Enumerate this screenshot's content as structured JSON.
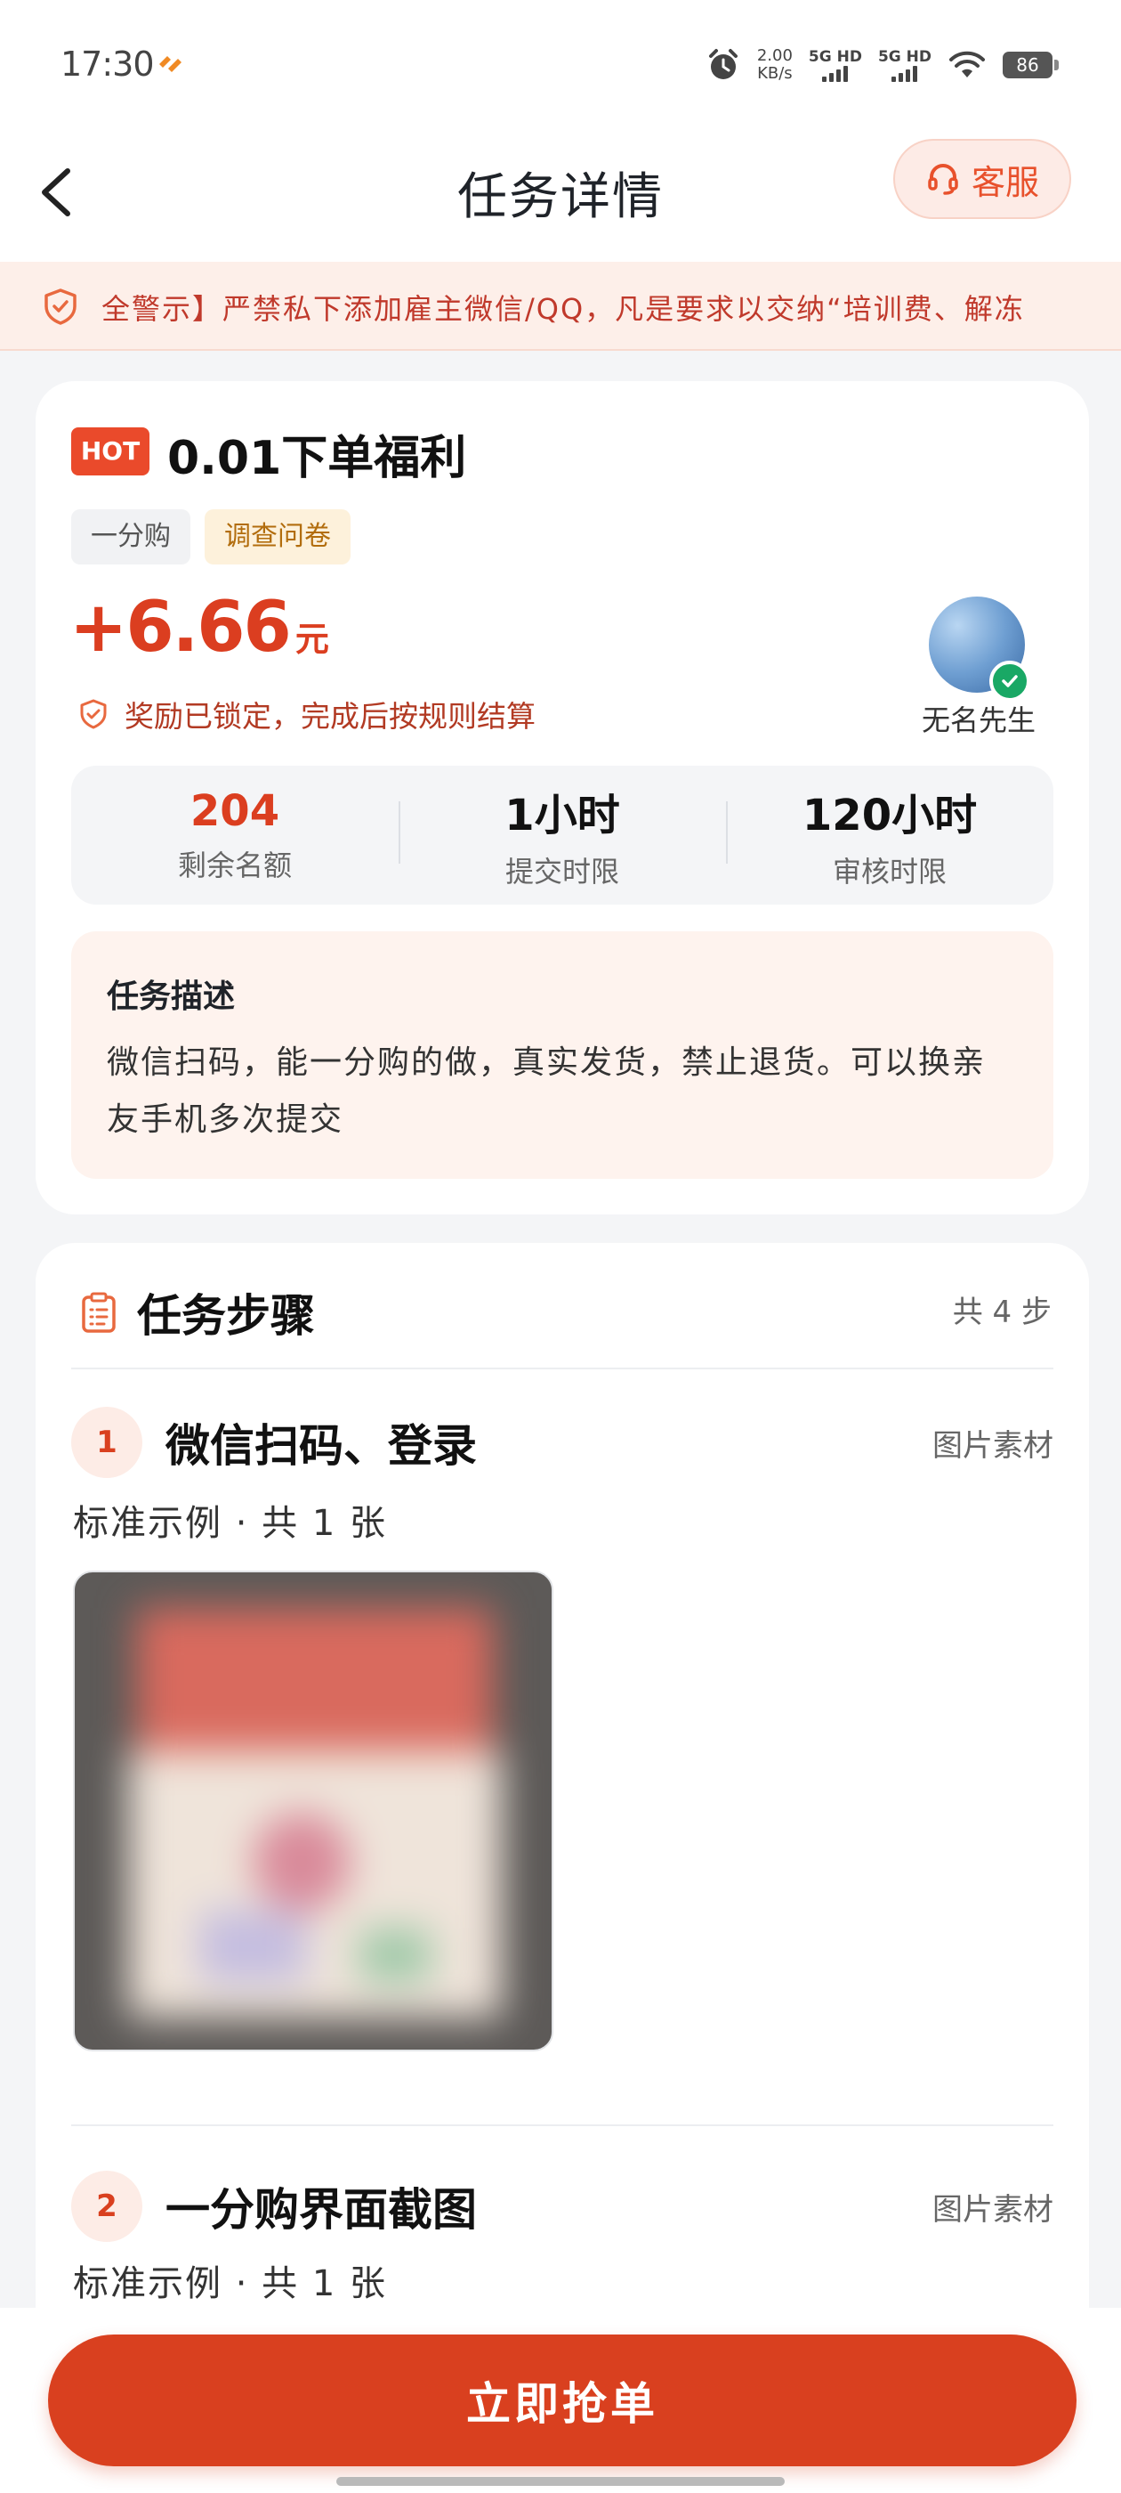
{
  "status_bar": {
    "time": "17:30",
    "net_speed_value": "2.00",
    "net_speed_unit": "KB/s",
    "sim1": "5G HD",
    "sim2": "5G HD",
    "battery": "86"
  },
  "header": {
    "title": "任务详情",
    "service_label": "客服"
  },
  "notice": {
    "text": "全警示】严禁私下添加雇主微信/QQ，凡是要求以交纳“培训费、解冻"
  },
  "task": {
    "hot_badge": "HOT",
    "title": "0.01下单福利",
    "tags": [
      "一分购",
      "调查问卷"
    ],
    "reward_amount": "+6.66",
    "reward_unit": "元",
    "lock_note": "奖励已锁定，完成后按规则结算",
    "publisher_name": "无名先生",
    "stats": [
      {
        "value": "204",
        "label": "剩余名额"
      },
      {
        "value": "1小时",
        "label": "提交时限"
      },
      {
        "value": "120小时",
        "label": "审核时限"
      }
    ],
    "description_heading": "任务描述",
    "description": "微信扫码，能一分购的做，真实发货，禁止退货。可以换亲友手机多次提交"
  },
  "steps": {
    "title": "任务步骤",
    "count": "共 4 步",
    "items": [
      {
        "number": "1",
        "title": "微信扫码、登录",
        "type": "图片素材",
        "example_label": "标准示例 · 共 1 张"
      },
      {
        "number": "2",
        "title": "一分购界面截图",
        "type": "图片素材",
        "example_label": "标准示例 · 共 1 张"
      }
    ]
  },
  "action": {
    "grab_label": "立即抢单"
  },
  "colors": {
    "accent": "#d9401f",
    "hot": "#ea4a2b",
    "verified": "#19a865"
  },
  "icons": [
    "back-arrow-icon",
    "headset-icon",
    "shield-icon",
    "clipboard-icon",
    "check-icon",
    "alarm-icon",
    "wifi-icon"
  ]
}
